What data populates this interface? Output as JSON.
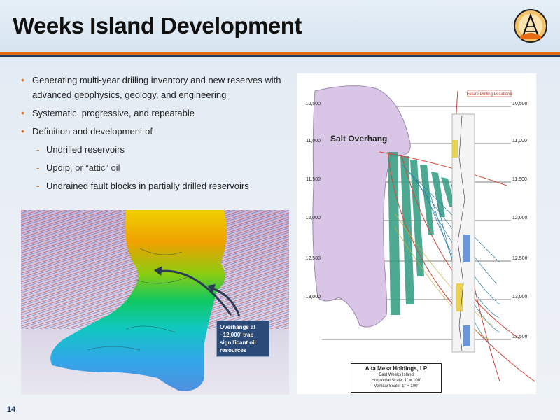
{
  "slide": {
    "title": "Weeks Island Development",
    "page_number": "14",
    "colors": {
      "accent": "#e76a12",
      "rule_dark": "#1f3c66",
      "callout": "#2b4a78"
    }
  },
  "bullets": {
    "main": [
      "Generating multi-year drilling inventory and new reserves with advanced geophysics, geology, and engineering",
      "Systematic, progressive, and repeatable",
      "Definition and development of"
    ],
    "sub": [
      "Undrilled reservoirs",
      "Updip",
      ", or “attic” oil",
      "Undrained fault blocks in partially drilled reservoirs"
    ]
  },
  "image_3d": {
    "callout": "Overhangs at ~12,000' trap significant oil resources"
  },
  "cross_section": {
    "salt_label": "Salt Overhang",
    "future_label": "Future Drilling Locations",
    "depth_left": [
      "10,500",
      "11,000",
      "11,500",
      "12,000",
      "12,500",
      "13,000"
    ],
    "depth_right": [
      "10,500",
      "11,000",
      "11,500",
      "12,000",
      "12,500",
      "13,000",
      "13,500"
    ],
    "legend": {
      "company": "Alta Mesa Holdings, LP",
      "field": "East Weeks Island",
      "horizontal_scale": "Horizontal Scale: 1\" = 100'",
      "vertical_scale": "Vertical Scale: 1\" = 100'"
    }
  }
}
